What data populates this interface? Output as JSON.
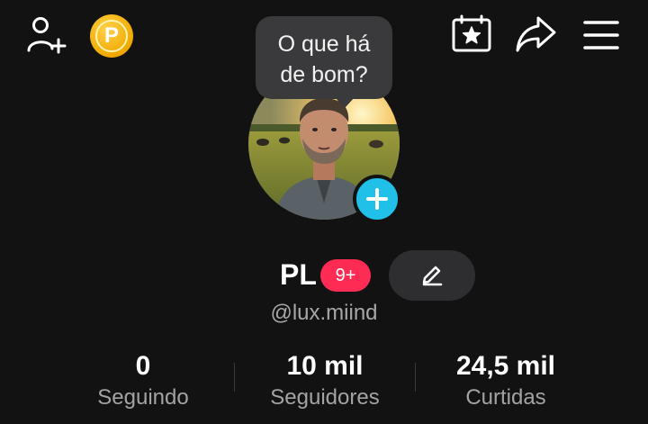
{
  "header": {
    "add_user_icon": "person-plus-icon",
    "coin_icon": "coin-icon",
    "coin_letter": "P",
    "calendar_icon": "calendar-star-icon",
    "share_icon": "share-arrow-icon",
    "menu_icon": "hamburger-menu-icon"
  },
  "status_bubble": {
    "line1": "O que há",
    "line2": "de bom?"
  },
  "profile": {
    "avatar_icon": "profile-photo",
    "add_icon": "plus-icon",
    "name": "PL",
    "notification_badge": "9+",
    "edit_icon": "pencil-icon",
    "handle": "@lux.miind"
  },
  "stats": [
    {
      "value": "0",
      "label": "Seguindo"
    },
    {
      "value": "10 mil",
      "label": "Seguidores"
    },
    {
      "value": "24,5 mil",
      "label": "Curtidas"
    }
  ],
  "colors": {
    "background": "#121212",
    "badge": "#fe2c55",
    "add_button": "#20c0e8",
    "coin": "#f0a800"
  }
}
